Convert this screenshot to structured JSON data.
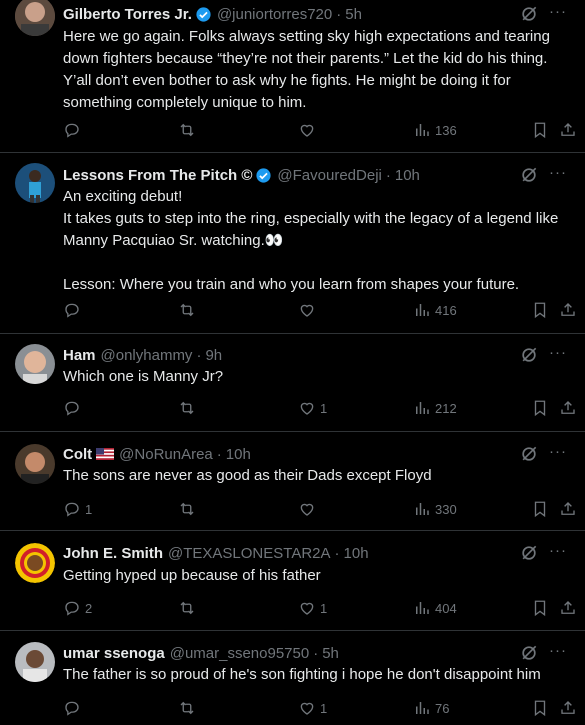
{
  "colors": {
    "background": "#000000",
    "text": "#e7e9ea",
    "muted": "#71767b",
    "verified": "#1d9bf0",
    "divider": "#2f3336"
  },
  "tweets": [
    {
      "name": "Gilberto Torres Jr.",
      "verified": true,
      "handle": "@juniortorres720",
      "time": "5h",
      "text": "Here we go again. Folks always setting sky high expectations and tearing down fighters because “they’re not their parents.” Let the kid do his thing. Y’all don’t even bother to ask why he fights. He might be doing it for something completely unique to him.",
      "replies": "",
      "retweets": "",
      "likes": "",
      "views": "136"
    },
    {
      "name": "Lessons From The Pitch ©",
      "verified": true,
      "handle": "@FavouredDeji",
      "time": "10h",
      "text": "An exciting debut!\nIt takes guts to step into the ring, especially with the legacy of a legend like Manny Pacquiao Sr. watching.👀\n\nLesson: Where you train and who you learn from shapes your future.",
      "replies": "",
      "retweets": "",
      "likes": "",
      "views": "416"
    },
    {
      "name": "Ham",
      "verified": false,
      "handle": "@onlyhammy",
      "time": "9h",
      "text": "Which one is Manny Jr?",
      "replies": "",
      "retweets": "",
      "likes": "1",
      "views": "212"
    },
    {
      "name": "Colt",
      "flag": "us-flag",
      "verified": false,
      "handle": "@NoRunArea",
      "time": "10h",
      "text": "The sons are never as good as their Dads except Floyd",
      "replies": "1",
      "retweets": "",
      "likes": "",
      "views": "330"
    },
    {
      "name": "John E. Smith",
      "verified": false,
      "handle": "@TEXASLONESTAR2A",
      "time": "10h",
      "text": "Getting hyped up because of his father",
      "replies": "2",
      "retweets": "",
      "likes": "1",
      "views": "404"
    },
    {
      "name": "umar ssenoga",
      "verified": false,
      "handle": "@umar_sseno95750",
      "time": "5h",
      "text": "The father is so proud of he's son fighting i hope he don't disappoint him",
      "replies": "",
      "retweets": "",
      "likes": "1",
      "views": "76"
    }
  ]
}
